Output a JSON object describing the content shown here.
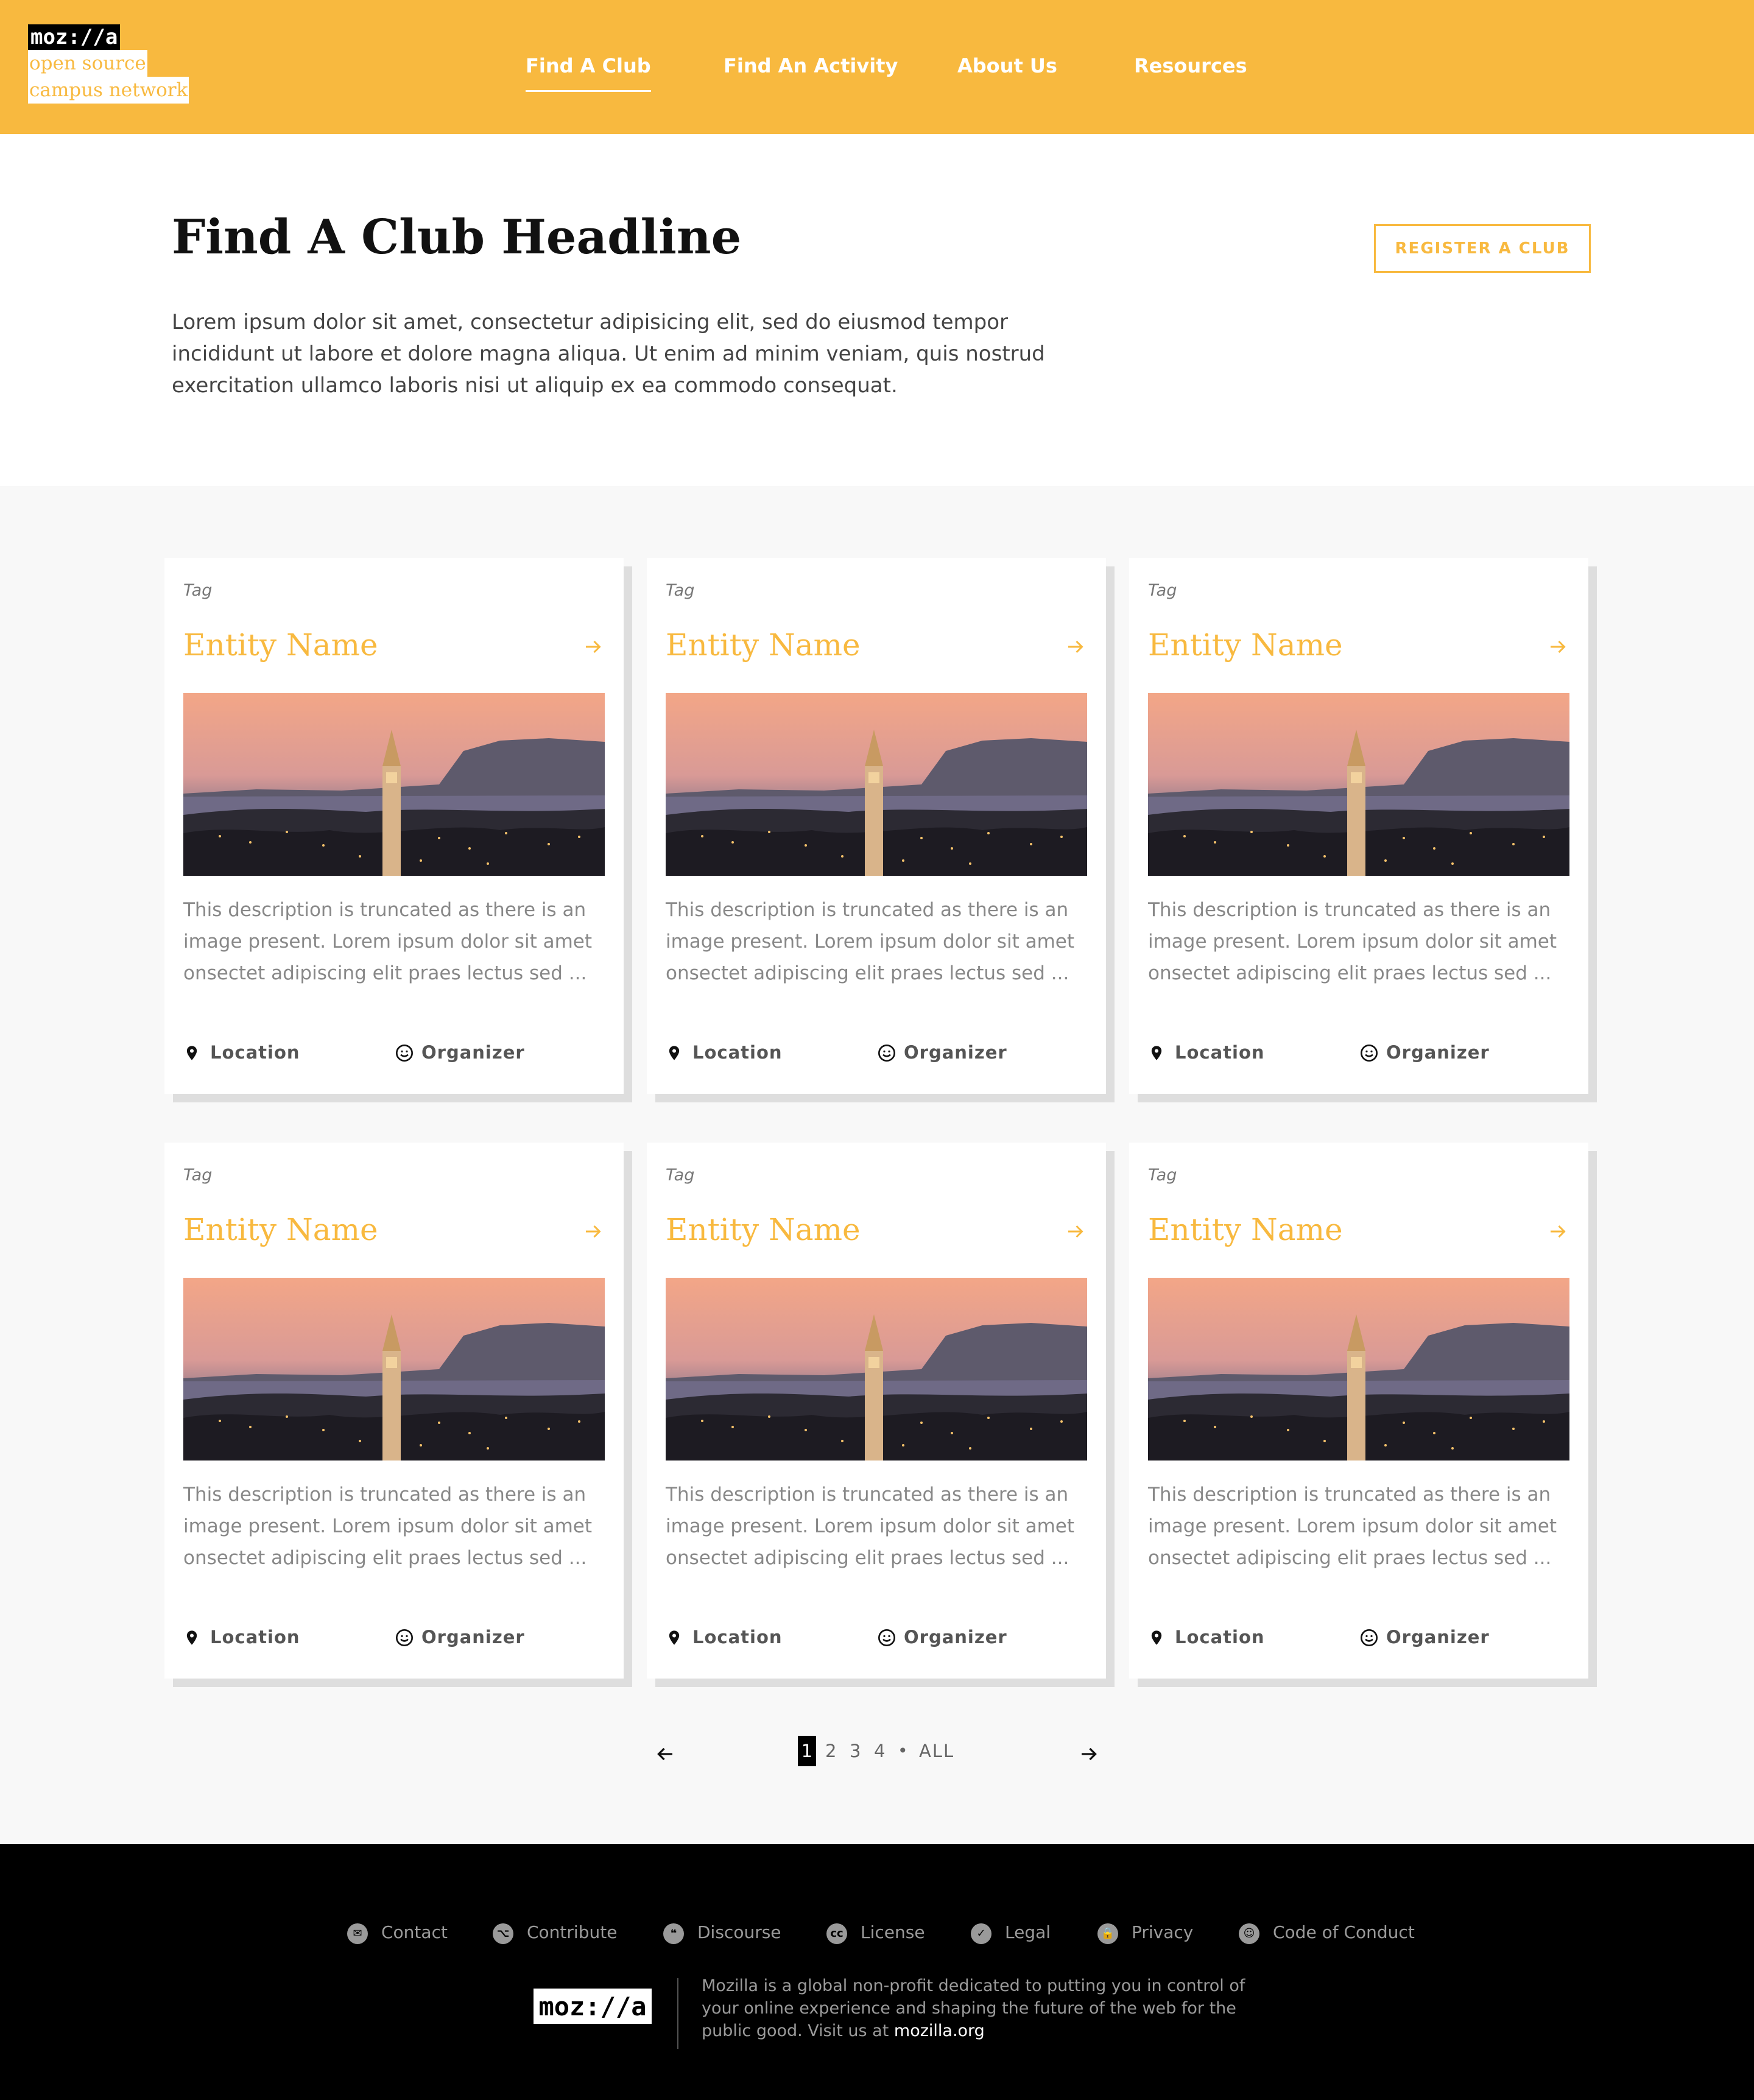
{
  "brand": {
    "wordmark": "moz://a",
    "line1": "open source",
    "line2": "campus network"
  },
  "nav": {
    "items": [
      {
        "label": "Find A Club",
        "active": true
      },
      {
        "label": "Find An Activity",
        "active": false
      },
      {
        "label": "About Us",
        "active": false
      },
      {
        "label": "Resources",
        "active": false
      }
    ]
  },
  "hero": {
    "title": "Find A Club Headline",
    "description": "Lorem ipsum dolor sit amet, consectetur adipisicing elit, sed do eiusmod tempor incididunt ut labore et dolore magna aliqua. Ut enim ad minim veniam, quis nostrud exercitation ullamco laboris nisi ut aliquip ex ea commodo consequat.",
    "register_button": "REGISTER A CLUB"
  },
  "cards": [
    {
      "tag": "Tag",
      "title": "Entity Name",
      "description": "This description is truncated as there is an image present. Lorem ipsum dolor sit amet onsectet adipiscing elit praes lectus sed ...",
      "location": "Location",
      "organizer": "Organizer",
      "arrow_icon": "arrow-right-icon"
    },
    {
      "tag": "Tag",
      "title": "Entity Name",
      "description": "This description is truncated as there is an image present. Lorem ipsum dolor sit amet onsectet adipiscing elit praes lectus sed ...",
      "location": "Location",
      "organizer": "Organizer",
      "arrow_icon": "arrow-right-icon"
    },
    {
      "tag": "Tag",
      "title": "Entity Name",
      "description": "This description is truncated as there is an image present. Lorem ipsum dolor sit amet onsectet adipiscing elit praes lectus sed ...",
      "location": "Location",
      "organizer": "Organizer",
      "arrow_icon": "arrow-right-icon"
    },
    {
      "tag": "Tag",
      "title": "Entity Name",
      "description": "This description is truncated as there is an image present. Lorem ipsum dolor sit amet onsectet adipiscing elit praes lectus sed ...",
      "location": "Location",
      "organizer": "Organizer",
      "arrow_icon": "arrow-right-icon"
    },
    {
      "tag": "Tag",
      "title": "Entity Name",
      "description": "This description is truncated as there is an image present. Lorem ipsum dolor sit amet onsectet adipiscing elit praes lectus sed ...",
      "location": "Location",
      "organizer": "Organizer",
      "arrow_icon": "arrow-right-icon"
    },
    {
      "tag": "Tag",
      "title": "Entity Name",
      "description": "This description is truncated as there is an image present. Lorem ipsum dolor sit amet onsectet adipiscing elit praes lectus sed ...",
      "location": "Location",
      "organizer": "Organizer",
      "arrow_icon": "arrow-right-icon"
    }
  ],
  "pagination": {
    "current": "1",
    "pages": [
      "1",
      "2",
      "3",
      "4"
    ],
    "separator": "•",
    "all_label": "ALL",
    "prev_icon": "arrow-left-icon",
    "next_icon": "arrow-right-icon"
  },
  "footer": {
    "links": [
      {
        "label": "Contact",
        "icon": "mail-icon",
        "glyph": "✉"
      },
      {
        "label": "Contribute",
        "icon": "github-icon",
        "glyph": "⌥"
      },
      {
        "label": "Discourse",
        "icon": "discourse-icon",
        "glyph": "❝"
      },
      {
        "label": "License",
        "icon": "creative-commons-icon",
        "glyph": "cc"
      },
      {
        "label": "Legal",
        "icon": "check-icon",
        "glyph": "✓"
      },
      {
        "label": "Privacy",
        "icon": "lock-icon",
        "glyph": "🔒"
      },
      {
        "label": "Code of Conduct",
        "icon": "smiley-icon",
        "glyph": "☺"
      }
    ],
    "wordmark": "moz://a",
    "about_text": "Mozilla is a global non-profit dedicated to putting you in control of your online experience and shaping the future of the web for the public good. Visit us at ",
    "about_link": "mozilla.org"
  },
  "colors": {
    "brand_yellow": "#f8b93f",
    "footer_bg": "#000000",
    "section_bg": "#f8f8f8"
  }
}
